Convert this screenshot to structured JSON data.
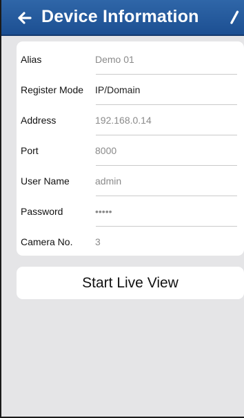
{
  "header": {
    "title": "Device Information",
    "back_icon": "left-arrow-icon",
    "edit_icon": "pencil-icon",
    "background_color": "#1f5395"
  },
  "device_info": {
    "rows": [
      {
        "label": "Alias",
        "value": "Demo 01"
      },
      {
        "label": "Register Mode",
        "value": "IP/Domain"
      },
      {
        "label": "Address",
        "value": "192.168.0.14"
      },
      {
        "label": "Port",
        "value": "8000"
      },
      {
        "label": "User Name",
        "value": "admin"
      },
      {
        "label": "Password",
        "value": "•••••"
      },
      {
        "label": "Camera No.",
        "value": "3"
      }
    ]
  },
  "actions": {
    "start_live_view": "Start Live View"
  }
}
